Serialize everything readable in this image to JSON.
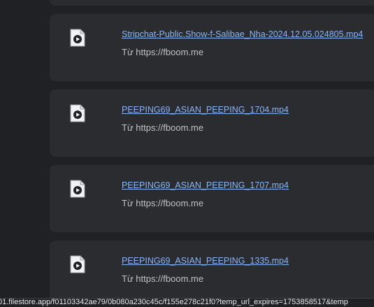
{
  "downloads": [
    {
      "filename": "Stripchat-Public.Show-f-Salibae_Nha-2024.12.05.024805.mp4",
      "source": "Từ https://fboom.me"
    },
    {
      "filename": "PEEPING69_ASIAN_PEEPING_1704.mp4",
      "source": "Từ https://fboom.me"
    },
    {
      "filename": "PEEPING69_ASIAN_PEEPING_1707.mp4",
      "source": "Từ https://fboom.me"
    },
    {
      "filename": "PEEPING69_ASIAN_PEEPING_1335.mp4",
      "source": "Từ https://fboom.me"
    }
  ],
  "status_bar": {
    "url": "01.filestore.app/f01103342ae79/0b080a230c45c/f155e278c21f0?temp_url_expires=1753858517&temp"
  },
  "colors": {
    "background": "#202124",
    "card": "#2b2c2f",
    "link": "#8ab4f8",
    "muted_text": "#bdc1c6"
  },
  "icons": {
    "file": "video-file-icon"
  }
}
